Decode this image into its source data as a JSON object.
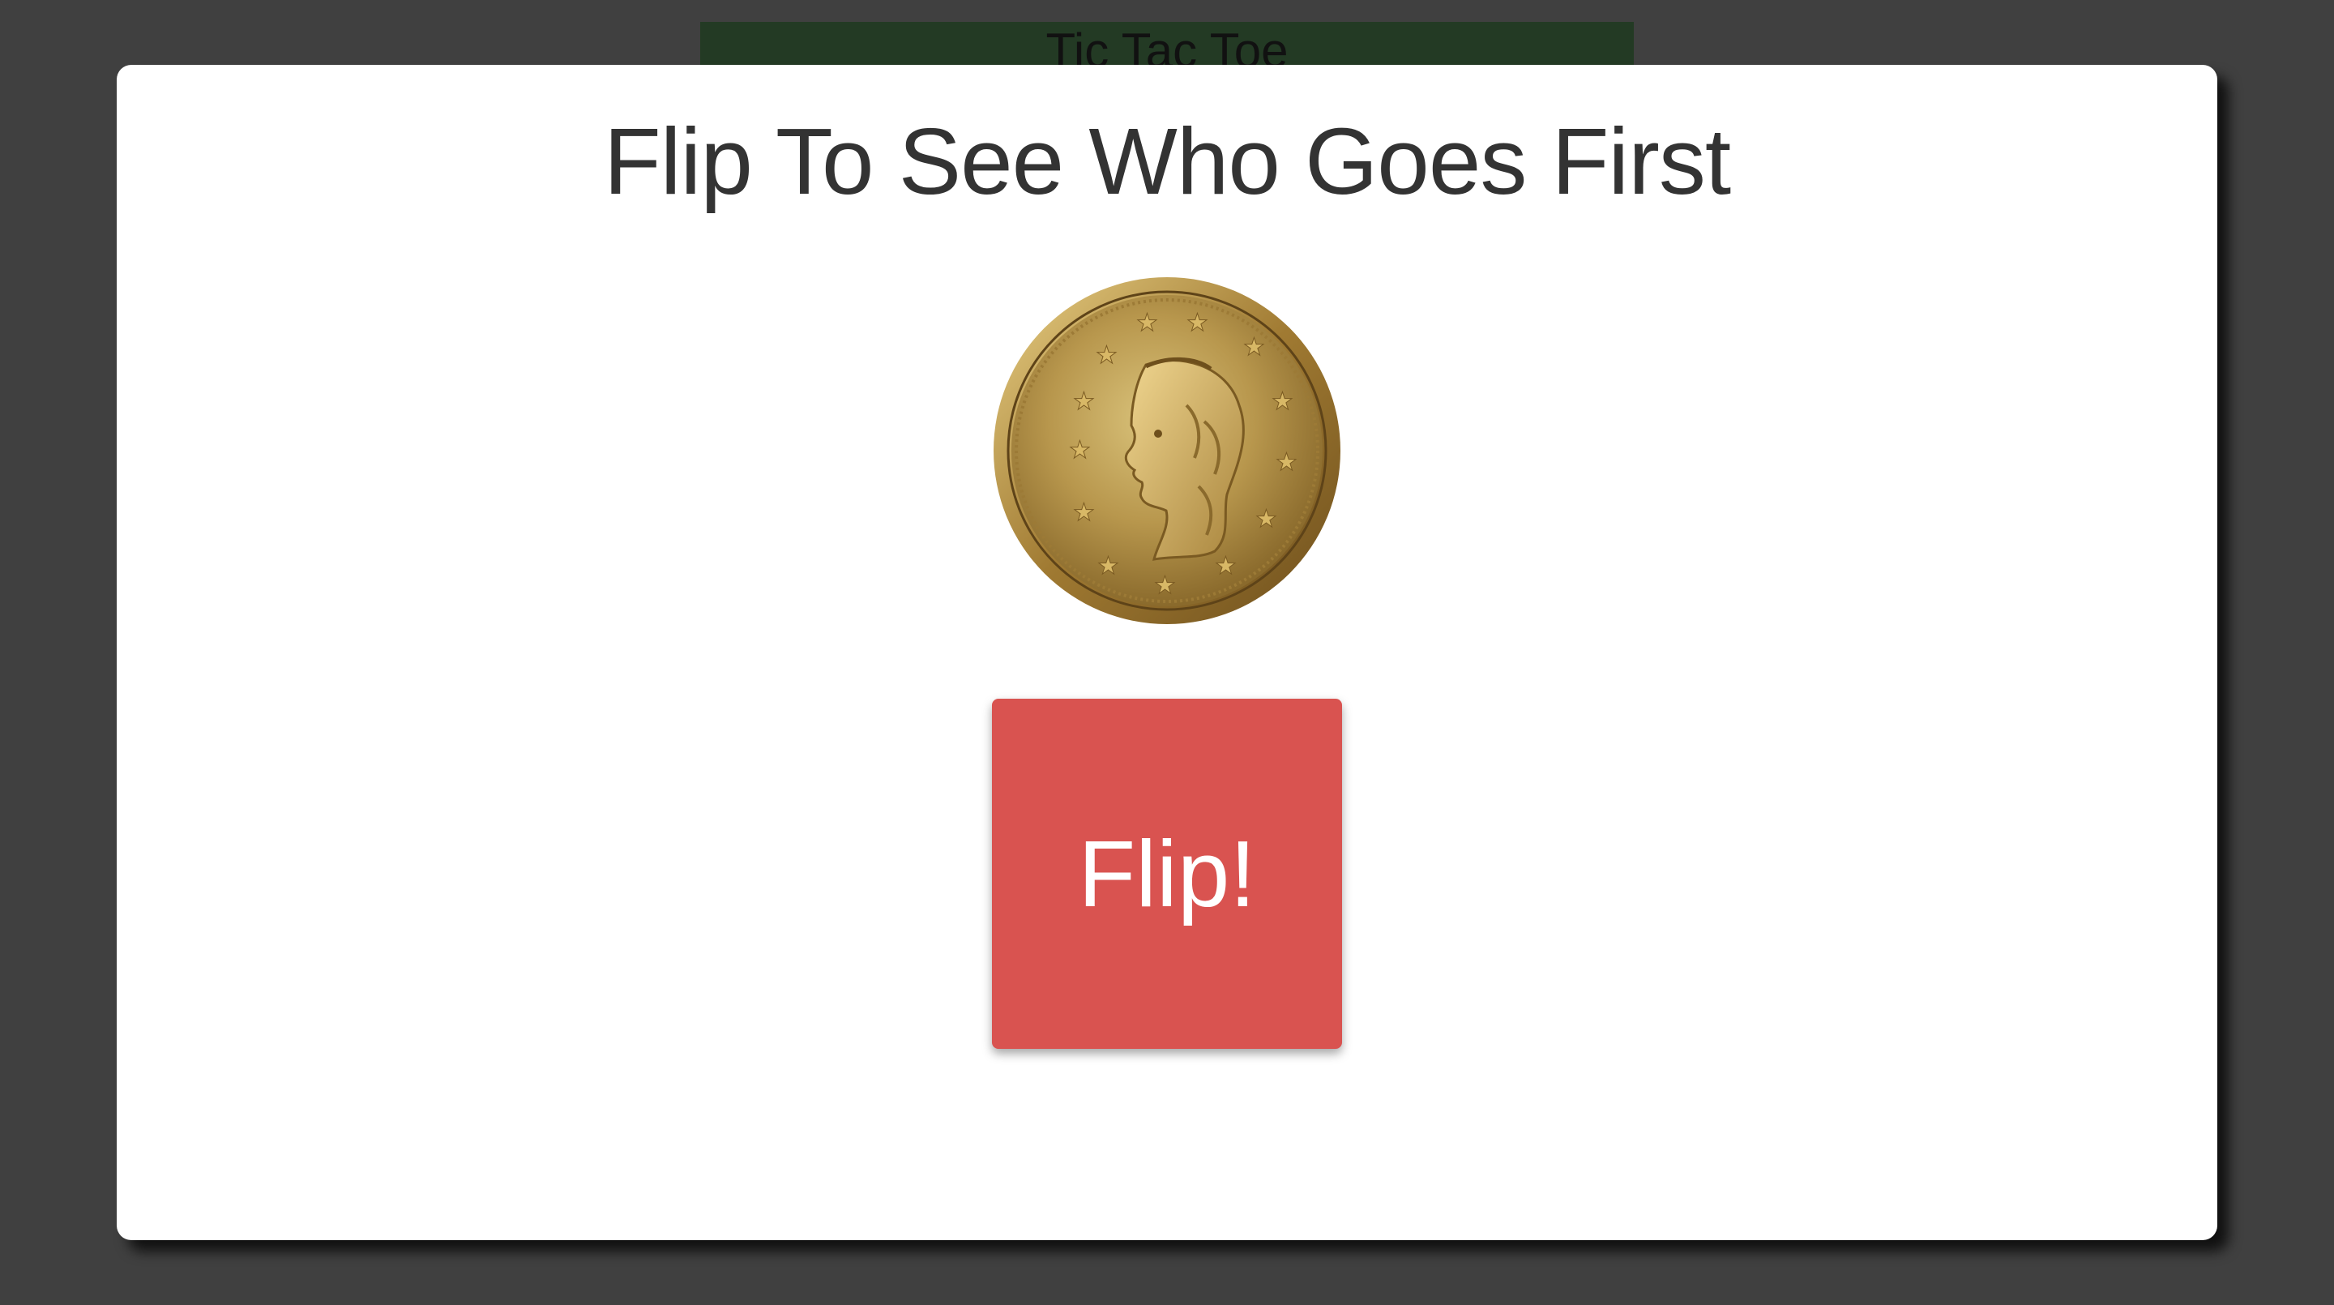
{
  "background_app": {
    "title": "Tic Tac Toe"
  },
  "modal": {
    "title": "Flip To See Who Goes First",
    "coin": {
      "icon": "gold-coin-icon",
      "face": "liberty-head"
    },
    "flip_button": {
      "label": "Flip!",
      "color": "#d95350"
    }
  },
  "colors": {
    "backdrop": "#404040",
    "header_bar": "#233a24",
    "modal_bg": "#ffffff",
    "title_text": "#333333"
  }
}
